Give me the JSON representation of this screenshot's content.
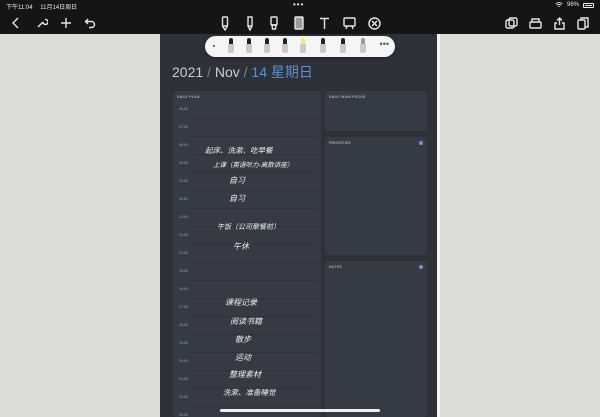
{
  "status": {
    "time": "下午11:04",
    "date": "11月14日周日",
    "dots": "•••",
    "battery": "96%"
  },
  "toolbar": {
    "left": [
      "back-icon",
      "wrench-icon",
      "add-icon",
      "undo-icon"
    ],
    "tools": [
      "pen-icon",
      "pencil-icon",
      "highlighter-icon",
      "eraser-icon",
      "text-icon",
      "lasso-icon",
      "close-circle-icon"
    ],
    "right": [
      "pages-icon",
      "scanner-icon",
      "share-icon",
      "copy-icon"
    ]
  },
  "palette": {
    "pens": [
      "black",
      "black",
      "black",
      "black",
      "yellow",
      "black",
      "black",
      "grey"
    ],
    "more": "•••",
    "colors": {
      "highlight": "#f2f05a",
      "ink": "#222222"
    }
  },
  "planner": {
    "year": "2021",
    "sep1": " / ",
    "month": "Nov",
    "sep2": " / ",
    "day": "14 星期日",
    "colors": {
      "accent": "#5d8fd8",
      "page": "#2c313a",
      "panel": "#353b45"
    },
    "daily_plan_label": "DAILY PLAN",
    "focus_label": "DAILY MAIN FOCUS",
    "priorities_label": "PRIORITIES",
    "notes_label": "NOTES",
    "hours": [
      "06:00",
      "07:00",
      "08:00",
      "09:00",
      "10:00",
      "11:00",
      "12:00",
      "13:00",
      "14:00",
      "15:00",
      "16:00",
      "17:00",
      "18:00",
      "19:00",
      "20:00",
      "21:00",
      "22:00",
      "23:00"
    ],
    "entries": [
      "起床、洗漱、吃早餐",
      "上课（英语听力-高数讲座）",
      "自习",
      "自习",
      "午饭（公司聚餐前）",
      "午休",
      "课程记录",
      "阅读书籍",
      "散步",
      "运动",
      "整理素材",
      "洗漱、准备睡觉"
    ]
  }
}
